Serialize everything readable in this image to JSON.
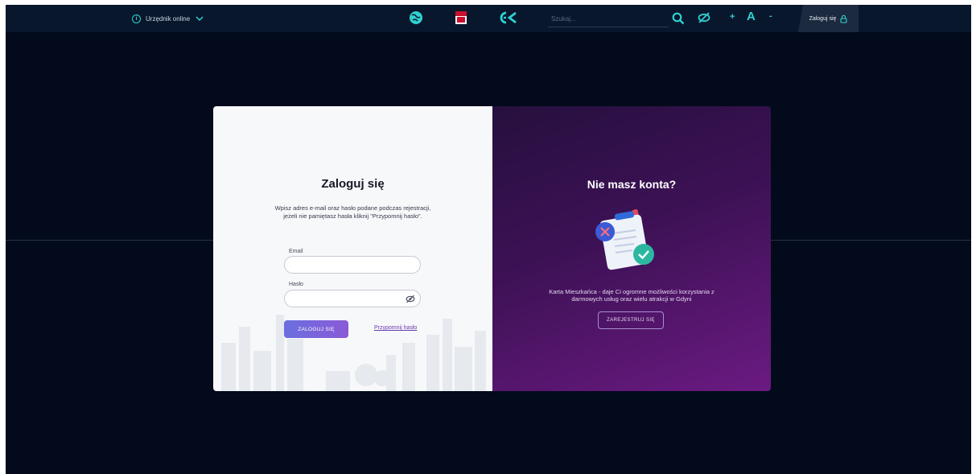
{
  "topbar": {
    "officer_label": "Urzędnik online",
    "search_placeholder": "Szukaj...",
    "font_plus": "+",
    "font_a": "A",
    "font_minus": "-",
    "login_label": "Zaloguj się"
  },
  "login": {
    "title": "Zaloguj się",
    "description": "Wpisz adres e-mail oraz hasło podane podczas rejestracji, jeżeli nie pamiętasz hasła kliknij \"Przypomnij hasło\".",
    "email_label": "Email",
    "password_label": "Hasło",
    "submit_label": "ZALOGUJ SIĘ",
    "remind_label": "Przypomnij hasło"
  },
  "register": {
    "title": "Nie masz konta?",
    "description": "Karta Mieszkańca - daje Ci ogromne możliwości korzystania z darmowych usług oraz wielu atrakcji w Gdyni",
    "button_label": "ZAREJESTRUJ SIĘ"
  },
  "colors": {
    "background": "#020a1b",
    "accent": "#2fd1d1",
    "purple": "#3d1155",
    "button_gradient_start": "#6a6fe0"
  }
}
